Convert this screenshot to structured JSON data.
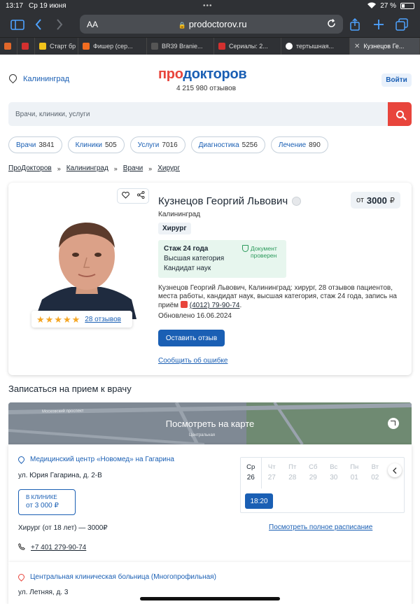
{
  "status_bar": {
    "time": "13:17",
    "date": "Ср 19 июня",
    "battery": "27 %",
    "battery_level_pct": 27
  },
  "browser": {
    "address_aa": "AA",
    "url": "prodoctorov.ru",
    "tabs": [
      {
        "label": "",
        "color": "#e0672a"
      },
      {
        "label": "",
        "color": "#d3302f"
      },
      {
        "label": "Старт бр",
        "color": "#f2c31b"
      },
      {
        "label": "Фишер (сер...",
        "color": "#f26d21"
      },
      {
        "label": "BR39 Branie...",
        "color": "#555555"
      },
      {
        "label": "Сериалы: 2...",
        "color": "#d3302f"
      },
      {
        "label": "тертышная...",
        "color": "#ffffff"
      },
      {
        "label": "Кузнецов Ге...",
        "color": "#888888"
      }
    ]
  },
  "header": {
    "city": "Калининград",
    "logo_part1": "про",
    "logo_part2": "докторов",
    "reviews": "4 215 980 отзывов",
    "login": "Войти"
  },
  "search": {
    "placeholder": "Врачи, клиники, услуги"
  },
  "categories": [
    {
      "label": "Врачи",
      "count": "3841"
    },
    {
      "label": "Клиники",
      "count": "505"
    },
    {
      "label": "Услуги",
      "count": "7016"
    },
    {
      "label": "Диагностика",
      "count": "5256"
    },
    {
      "label": "Лечение",
      "count": "890"
    }
  ],
  "breadcrumb": [
    "ПроДокторов",
    "Калининград",
    "Врачи",
    "Хирург"
  ],
  "doctor": {
    "name": "Кузнецов Георгий Львович",
    "price_prefix": "от",
    "price": "3000",
    "currency": "₽",
    "city": "Калининград",
    "specialty": "Хирург",
    "experience": "Стаж 24 года",
    "category": "Высшая категория",
    "degree": "Кандидат наук",
    "docs_line1": "Документ",
    "docs_line2": "проверен",
    "description": "Кузнецов Георгий Львович, Калининград: хирург, 28 отзывов пациентов, места работы, кандидат наук, высшая категория, стаж 24 года, запись на приём",
    "phone": "(4012) 79-90-74",
    "updated": "Обновлено 16.06.2024",
    "review_btn": "Оставить отзыв",
    "error_link": "Сообщить об ошибке",
    "rating_stars": 5,
    "reviews_link": "28 отзывов"
  },
  "appointment": {
    "title": "Записаться на прием к врачу",
    "map_label": "Посмотреть на карте",
    "map_street_1": "Московский проспект",
    "map_street_2": "Центральная"
  },
  "clinic1": {
    "name": "Медицинский центр «Новомед» на Гагарина",
    "address": "ул. Юрия Гагарина, д. 2-В",
    "in_clinic": "В КЛИНИКЕ",
    "price": "от 3 000 ₽",
    "service": "Хирург (от 18 лет) — 3000₽",
    "phone": "+7 401 279-90-74",
    "days": [
      {
        "name": "Ср",
        "num": "26"
      },
      {
        "name": "Чт",
        "num": "27"
      },
      {
        "name": "Пт",
        "num": "28"
      },
      {
        "name": "Сб",
        "num": "29"
      },
      {
        "name": "Вс",
        "num": "30"
      },
      {
        "name": "Пн",
        "num": "01"
      },
      {
        "name": "Вт",
        "num": "02"
      }
    ],
    "slot": "18:20",
    "full_schedule": "Посмотреть полное расписание"
  },
  "clinic2": {
    "name": "Центральная клиническая больница (Многопрофильная)",
    "address": "ул. Летняя, д. 3"
  }
}
